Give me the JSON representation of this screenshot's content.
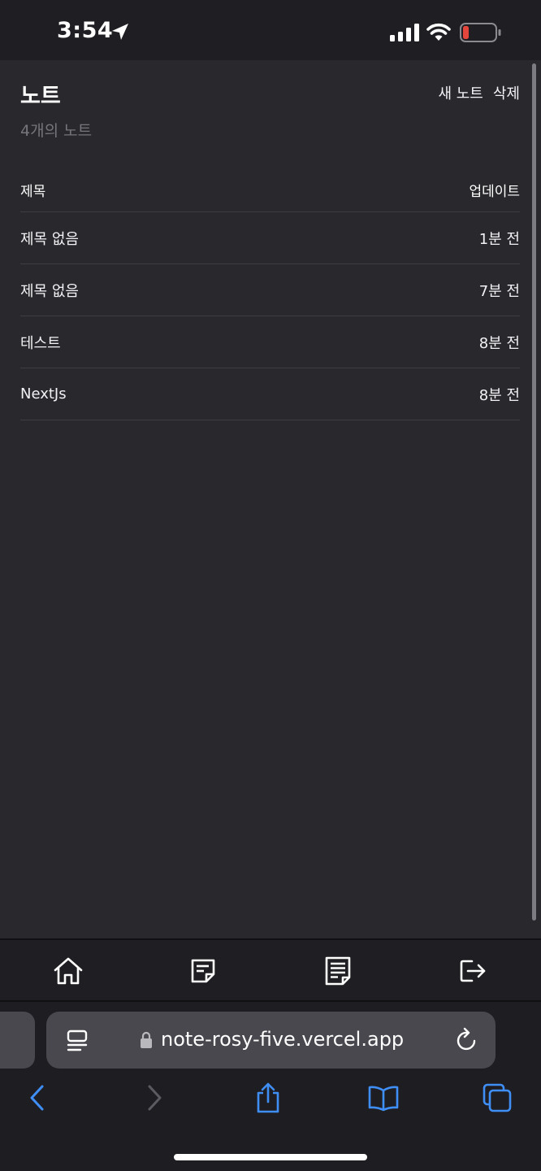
{
  "status_bar": {
    "time": "3:54",
    "icons": [
      "location-arrow-icon",
      "signal-icon",
      "wifi-icon",
      "battery-low-icon"
    ],
    "battery_color": "#e5463c"
  },
  "page": {
    "title": "노트",
    "note_count": "4개의 노트",
    "actions": {
      "new_note": "새 노트",
      "delete": "삭제"
    },
    "table": {
      "headers": {
        "title": "제목",
        "updated": "업데이트"
      },
      "rows": [
        {
          "title": "제목 없음",
          "updated": "1분 전"
        },
        {
          "title": "제목 없음",
          "updated": "7분 전"
        },
        {
          "title": "테스트",
          "updated": "8분 전"
        },
        {
          "title": "NextJs",
          "updated": "8분 전"
        }
      ]
    }
  },
  "app_nav": {
    "items": [
      "home-icon",
      "note-icon",
      "notes-list-icon",
      "logout-icon"
    ]
  },
  "safari": {
    "url": "note-rosy-five.vercel.app",
    "accent_color": "#3f8ef5",
    "toolbar": [
      "back-icon",
      "forward-icon",
      "share-icon",
      "bookmarks-icon",
      "tabs-icon"
    ]
  }
}
